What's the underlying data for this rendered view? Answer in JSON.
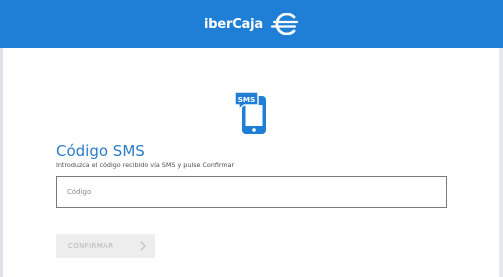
{
  "header": {
    "logo_text": "iberCaja",
    "brand_color": "#1f7fd6",
    "logo_icon": "ibercaja-logo-mark-icon"
  },
  "page": {
    "icon": "sms-phone-icon",
    "icon_badge_text": "SMS",
    "title": "Código SMS",
    "subtitle": "Introduzca el código recibido vía SMS y pulse Confirmar"
  },
  "form": {
    "code_placeholder": "Código",
    "code_value": "",
    "confirm_label": "CONFIRMAR",
    "confirm_icon": "chevron-right-icon",
    "confirm_disabled": true
  },
  "colors": {
    "title": "#2a7bc7",
    "icon": "#1f7fd6",
    "button_bg": "#ededed",
    "button_text": "#b5b5b5"
  }
}
